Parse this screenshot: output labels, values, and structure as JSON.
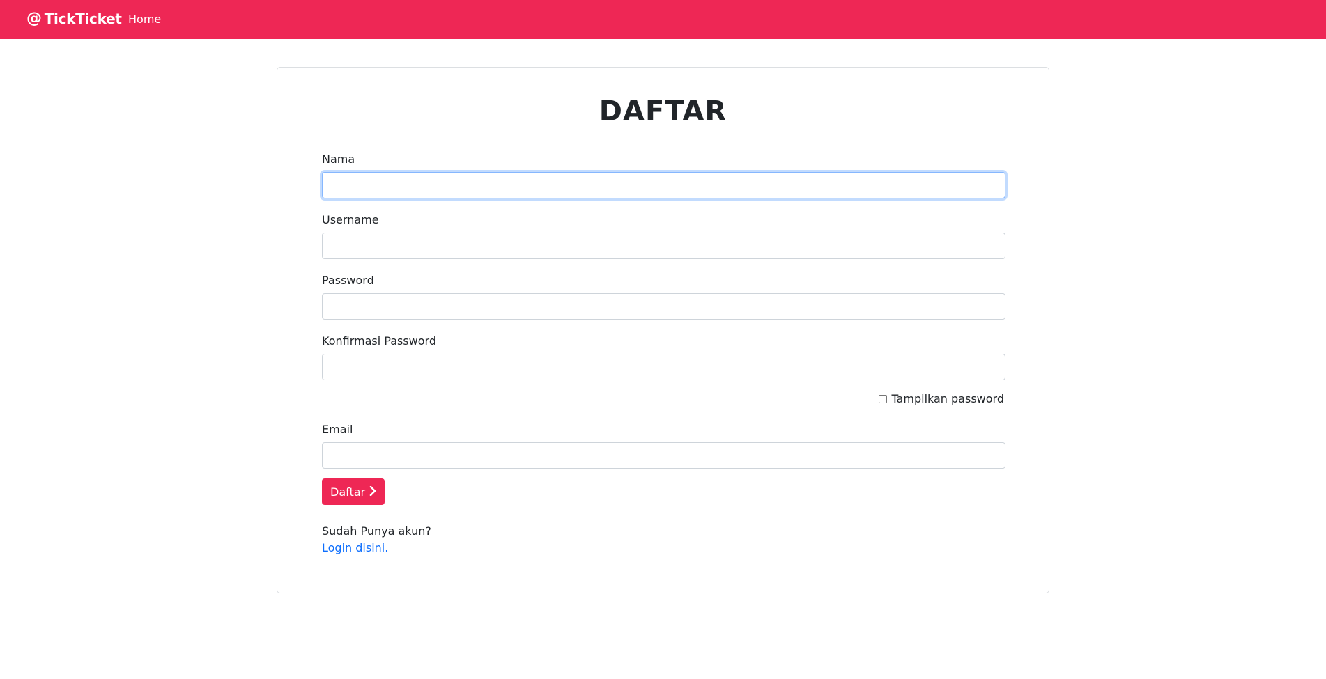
{
  "navbar": {
    "brand_icon": "@",
    "brand": "TickTicket",
    "home": "Home",
    "color": "#ee2755"
  },
  "form": {
    "title": "DAFTAR",
    "nama_label": "Nama",
    "nama_value": "",
    "username_label": "Username",
    "username_value": "",
    "password_label": "Password",
    "password_value": "",
    "confirm_label": "Konfirmasi Password",
    "confirm_value": "",
    "show_password_label": "Tampilkan password",
    "show_password_checked": false,
    "email_label": "Email",
    "email_value": "",
    "submit_label": "Daftar",
    "submit_icon": "chevron-right-icon",
    "have_account": "Sudah Punya akun?",
    "login_link": "Login disini",
    "login_suffix": "."
  }
}
